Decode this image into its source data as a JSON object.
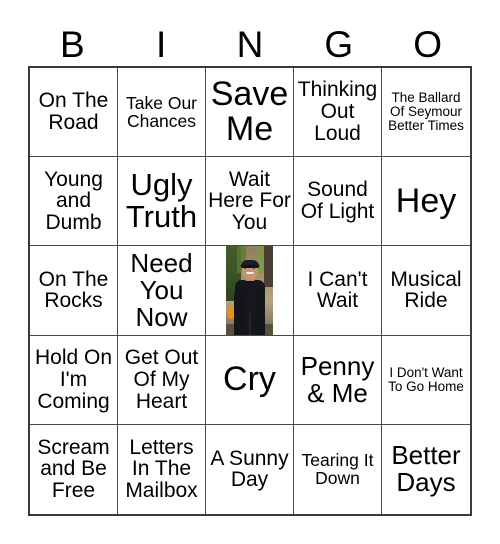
{
  "card": {
    "header_letters": [
      "B",
      "I",
      "N",
      "G",
      "O"
    ],
    "rows": [
      [
        {
          "text": "On The Road",
          "size": "fs-m"
        },
        {
          "text": "Take Our Chances",
          "size": "fs-s"
        },
        {
          "text": "Save Me",
          "size": "fs-xxl"
        },
        {
          "text": "Thinking Out Loud",
          "size": "fs-m"
        },
        {
          "text": "The Ballard Of Seymour Better Times",
          "size": "fs-xs"
        }
      ],
      [
        {
          "text": "Young and Dumb",
          "size": "fs-m"
        },
        {
          "text": "Ugly Truth",
          "size": "fs-xl"
        },
        {
          "text": "Wait Here For You",
          "size": "fs-m"
        },
        {
          "text": "Sound Of Light",
          "size": "fs-m"
        },
        {
          "text": "Hey",
          "size": "fs-xxl"
        }
      ],
      [
        {
          "text": "On The Rocks",
          "size": "fs-m"
        },
        {
          "text": "Need You Now",
          "size": "fs-l"
        },
        {
          "text": "",
          "size": "free-space-photo"
        },
        {
          "text": "I Can't Wait",
          "size": "fs-m"
        },
        {
          "text": "Musical Ride",
          "size": "fs-m"
        }
      ],
      [
        {
          "text": "Hold On I'm Coming",
          "size": "fs-m"
        },
        {
          "text": "Get Out Of My Heart",
          "size": "fs-m"
        },
        {
          "text": "Cry",
          "size": "fs-xxl"
        },
        {
          "text": "Penny & Me",
          "size": "fs-l"
        },
        {
          "text": "I Don't Want To Go Home",
          "size": "fs-xs"
        }
      ],
      [
        {
          "text": "Scream and Be Free",
          "size": "fs-m"
        },
        {
          "text": "Letters In The Mailbox",
          "size": "fs-m"
        },
        {
          "text": "A Sunny Day",
          "size": "fs-m"
        },
        {
          "text": "Tearing It Down",
          "size": "fs-s"
        },
        {
          "text": "Better Days",
          "size": "fs-l"
        }
      ]
    ],
    "free_space": {
      "description": "photo of a smiling man wearing a dark cap and black jacket"
    },
    "colors": {
      "background": "#ffffff",
      "text": "#000000",
      "grid_border": "#3a3a3a",
      "cell_border": "#4a4a4a"
    }
  }
}
